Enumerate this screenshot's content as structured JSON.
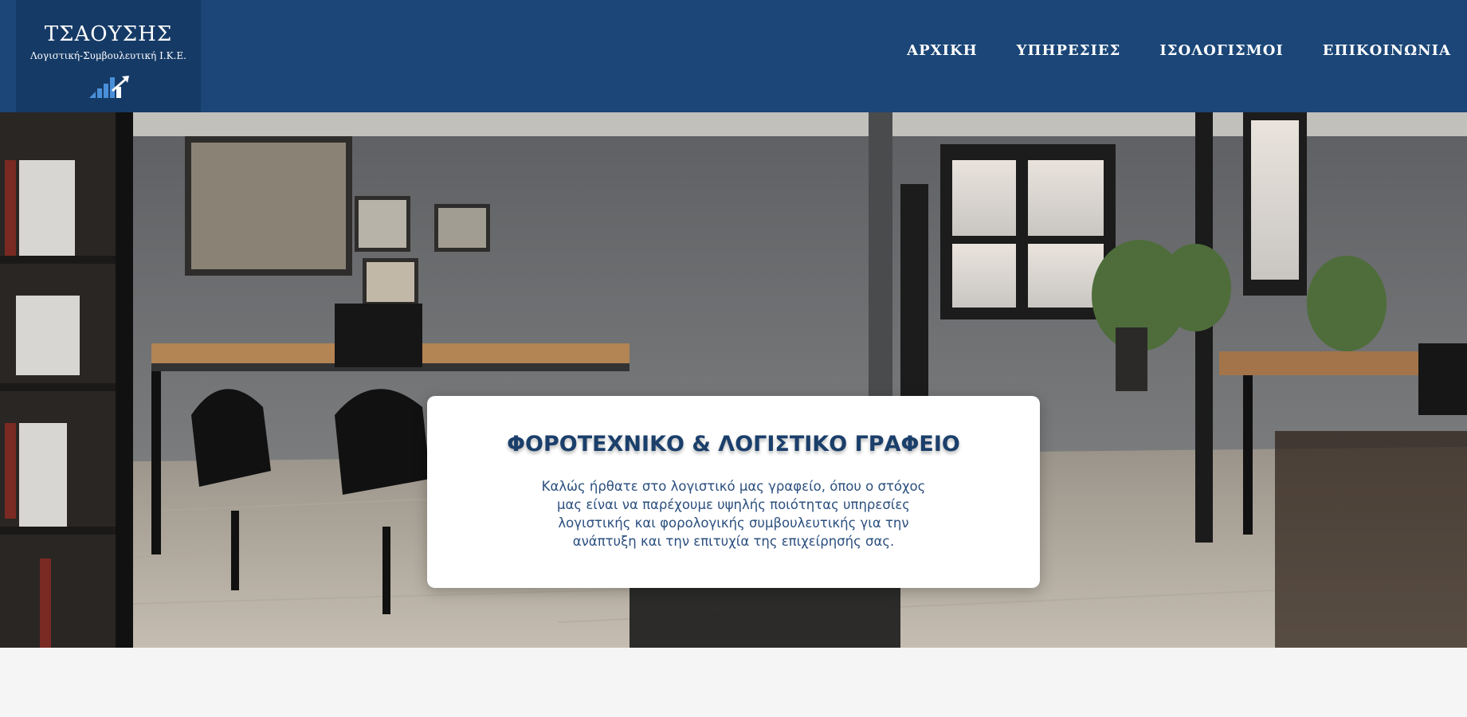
{
  "brand": {
    "name": "ΤΣΑΟΥΣΗΣ",
    "subtitle": "Λογιστική-Συμβουλευτική Ι.Κ.Ε.",
    "logo_icon": "bar-chart-arrow-icon"
  },
  "nav": {
    "items": [
      {
        "label": "ΑΡΧΙΚΗ"
      },
      {
        "label": "ΥΠΗΡΕΣΙΕΣ"
      },
      {
        "label": "ΙΣΟΛΟΓΙΣΜΟΙ"
      },
      {
        "label": "ΕΠΙΚΟΙΝΩΝΙΑ"
      }
    ]
  },
  "hero": {
    "title": "ΦΟΡΟΤΕΧΝΙΚΟ & ΛΟΓΙΣΤΙΚΟ ΓΡΑΦΕΙΟ",
    "text": "Καλώς ήρθατε στο λογιστικό μας γραφείο, όπου ο στόχος μας είναι να παρέχουμε υψηλής ποιότητας υπηρεσίες λογιστικής και φορολογικής συμβουλευτικής για την ανάπτυξη και την επιτυχία της επιχείρησής σας."
  },
  "colors": {
    "header_bg": "#1b4677",
    "logo_bg": "#153a66",
    "title": "#1b3f6b",
    "body_text": "#2b4f7e",
    "page_bg": "#f5f5f5"
  }
}
